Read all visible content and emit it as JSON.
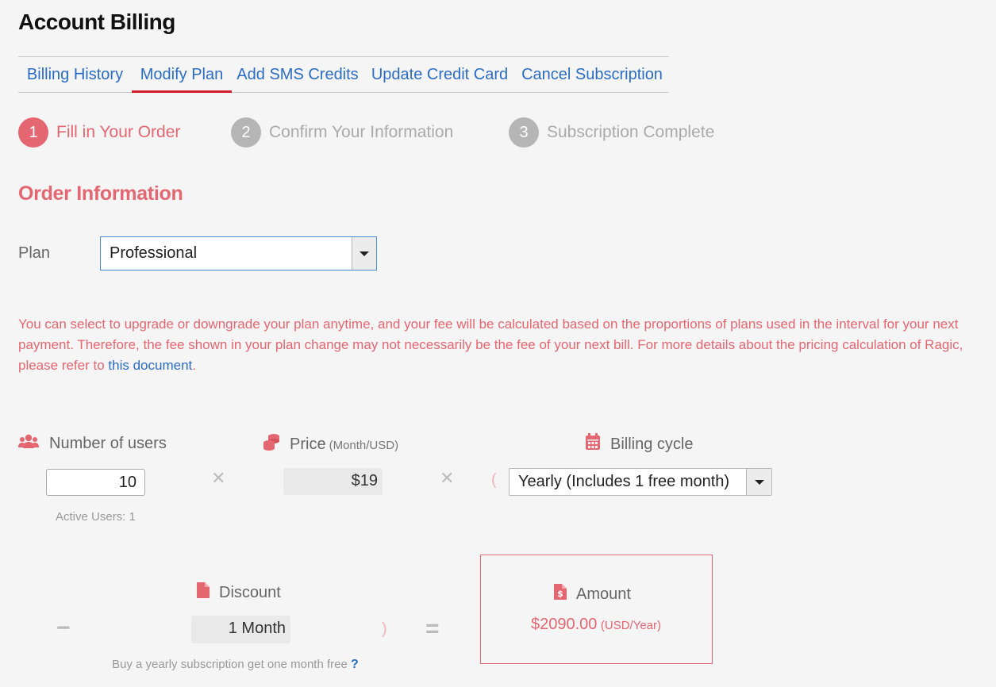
{
  "page_title": "Account Billing",
  "tabs": [
    {
      "label": "Billing History"
    },
    {
      "label": "Modify Plan"
    },
    {
      "label": "Add SMS Credits"
    },
    {
      "label": "Update Credit Card"
    },
    {
      "label": "Cancel Subscription"
    }
  ],
  "active_tab": "Modify Plan",
  "steps": [
    {
      "number": "1",
      "label": "Fill in Your Order"
    },
    {
      "number": "2",
      "label": "Confirm Your Information"
    },
    {
      "number": "3",
      "label": "Subscription Complete"
    }
  ],
  "section_title": "Order Information",
  "plan": {
    "label": "Plan",
    "selected": "Professional"
  },
  "notice": {
    "text": "You can select to upgrade or downgrade your plan anytime, and your fee will be calculated based on the proportions of plans used in the interval for your next payment. Therefore, the fee shown in your plan change may not necessarily be the fee of your next bill. For more details about the pricing calculation of Ragic, please refer to ",
    "link": "this document",
    "end": "."
  },
  "users": {
    "label": "Number of users",
    "value": "10",
    "active_users": "Active Users: 1",
    "icon": "users-icon"
  },
  "price": {
    "label": "Price",
    "unit": "(Month/USD)",
    "value": "$19",
    "icon": "coins-icon"
  },
  "billing_cycle": {
    "label": "Billing cycle",
    "selected": "Yearly (Includes 1 free month)",
    "icon": "calendar-icon"
  },
  "operators": {
    "times": "✕",
    "minus": "−",
    "equals": "=",
    "open_paren": "(",
    "close_paren": ")"
  },
  "discount": {
    "label": "Discount",
    "value": "1 Month",
    "note": "Buy a yearly subscription get one month free",
    "help": "?",
    "icon": "file-icon"
  },
  "amount": {
    "label": "Amount",
    "value": "$2090.00",
    "unit": "(USD/Year)",
    "icon": "invoice-dollar-icon"
  },
  "colors": {
    "accent": "#e46670",
    "link": "#2b6cc4",
    "active_tab_underline": "#d21f2a",
    "step_inactive": "#b5b5b5"
  }
}
